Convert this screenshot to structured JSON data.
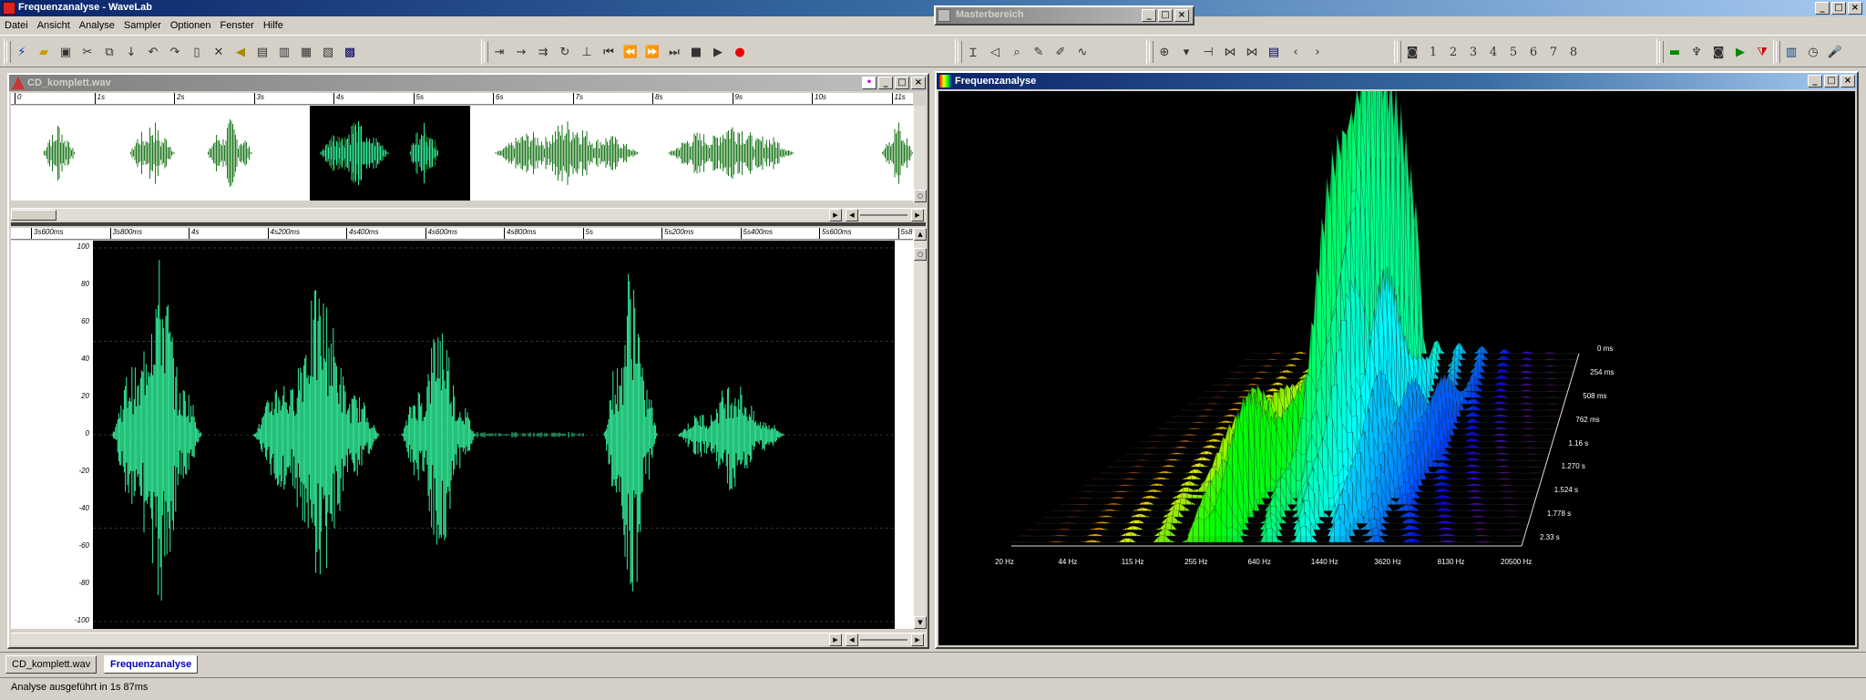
{
  "app": {
    "title": "Frequenzanalyse - WaveLab"
  },
  "menu": [
    "Datei",
    "Ansicht",
    "Analyse",
    "Sampler",
    "Optionen",
    "Fenster",
    "Hilfe"
  ],
  "master": {
    "title": "Masterbereich"
  },
  "toolbar": {
    "numbers": [
      "1",
      "2",
      "3",
      "4",
      "5",
      "6",
      "7",
      "8"
    ]
  },
  "wave_window": {
    "title": "CD_komplett.wav",
    "top_ruler": [
      "0",
      "1s",
      "2s",
      "3s",
      "4s",
      "5s",
      "6s",
      "7s",
      "8s",
      "9s",
      "10s",
      "11s"
    ],
    "detail_ruler": [
      "3s600ms",
      "3s800ms",
      "4s",
      "4s200ms",
      "4s400ms",
      "4s600ms",
      "4s800ms",
      "5s",
      "5s200ms",
      "5s400ms",
      "5s600ms",
      "5s8"
    ],
    "y_labels": [
      "100",
      "80",
      "60",
      "40",
      "20",
      "0",
      "-20",
      "-40",
      "-60",
      "-80",
      "-100"
    ]
  },
  "freq_window": {
    "title": "Frequenzanalyse",
    "x_labels": [
      "20 Hz",
      "44 Hz",
      "115 Hz",
      "255 Hz",
      "640 Hz",
      "1440 Hz",
      "3620 Hz",
      "8130 Hz",
      "20500 Hz"
    ],
    "z_labels": [
      "0 ms",
      "254 ms",
      "508 ms",
      "762 ms",
      "1.16 s",
      "1.270 s",
      "1.524 s",
      "1.778 s",
      "2.33 s"
    ]
  },
  "tabs": [
    {
      "label": "CD_komplett.wav",
      "active": false
    },
    {
      "label": "Frequenzanalyse",
      "active": true
    }
  ],
  "status": {
    "text": "Analyse ausgeführt in 1s 87ms"
  },
  "colors": {
    "wave": "#33ee99",
    "overview_wave": "#1f7a1f",
    "title_active": "#0a246a"
  }
}
